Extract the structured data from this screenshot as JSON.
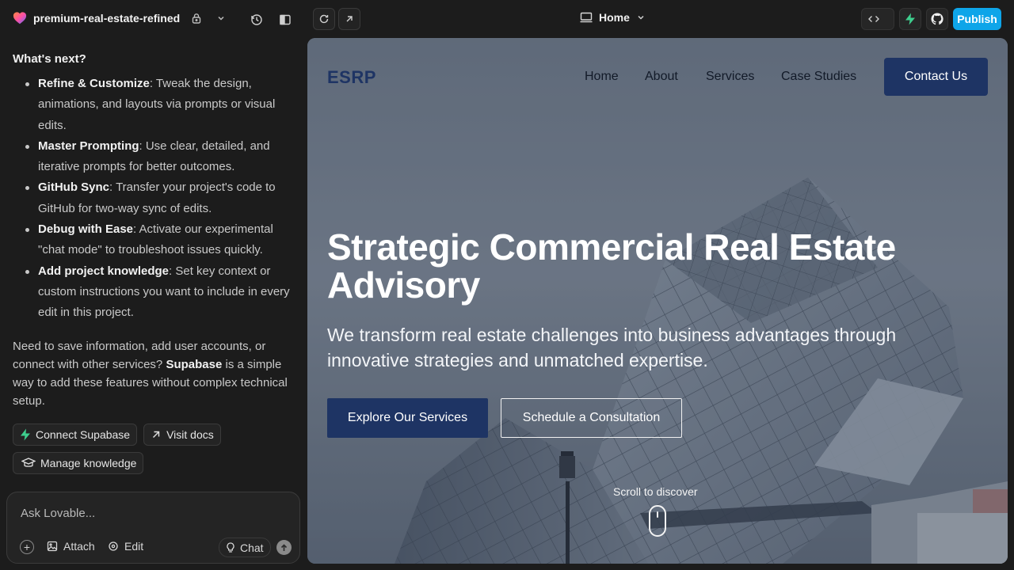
{
  "topbar": {
    "project_name": "premium-real-estate-refined",
    "route": "Home",
    "publish_label": "Publish"
  },
  "chat": {
    "next_heading": "What's next?",
    "next_items": [
      {
        "title": "Refine & Customize",
        "text": ": Tweak the design, animations, and layouts via prompts or visual edits."
      },
      {
        "title": "Master Prompting",
        "text": ": Use clear, detailed, and iterative prompts for better outcomes."
      },
      {
        "title": "GitHub Sync",
        "text": ": Transfer your project's code to GitHub for two-way sync of edits."
      },
      {
        "title": "Debug with Ease",
        "text": ": Activate our experimental \"chat mode\" to troubleshoot issues quickly."
      },
      {
        "title": "Add project knowledge",
        "text": ": Set key context or custom instructions you want to include in every edit in this project."
      }
    ],
    "para_pre": "Need to save information, add user accounts, or connect with other services? ",
    "para_bold": "Supabase",
    "para_post": " is a simple way to add these features without complex technical setup.",
    "chips": {
      "connect_supabase": "Connect Supabase",
      "visit_docs": "Visit docs",
      "manage_knowledge": "Manage knowledge"
    },
    "composer": {
      "placeholder": "Ask Lovable...",
      "attach": "Attach",
      "edit": "Edit",
      "chat": "Chat"
    }
  },
  "site": {
    "logo": "ESRP",
    "nav": [
      "Home",
      "About",
      "Services",
      "Case Studies"
    ],
    "contact": "Contact Us",
    "hero_title": "Strategic Commercial Real Estate Advisory",
    "hero_sub": "We transform real estate challenges into business advantages through innovative strategies and unmatched expertise.",
    "cta_primary": "Explore Our Services",
    "cta_secondary": "Schedule a Consultation",
    "scroll_label": "Scroll to discover"
  },
  "colors": {
    "accent": "#0ea5e9",
    "brand_navy": "#1e3464",
    "supabase_green": "#3ecf8e"
  }
}
